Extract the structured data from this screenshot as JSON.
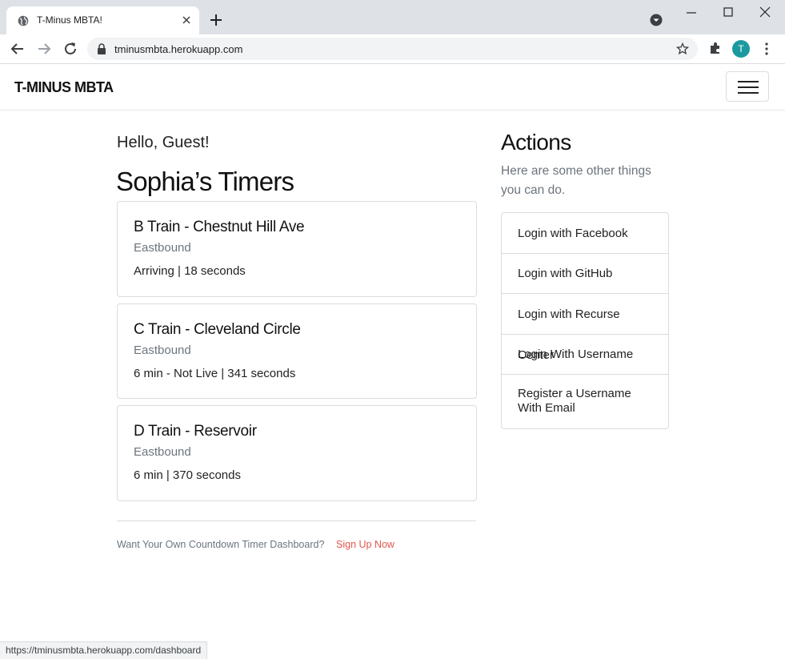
{
  "browser": {
    "tab_title": "T-Minus MBTA!",
    "url": "tminusmbta.herokuapp.com",
    "avatar_letter": "T",
    "status_url": "https://tminusmbta.herokuapp.com/dashboard"
  },
  "navbar": {
    "brand": "T-MINUS MBTA"
  },
  "main": {
    "greeting": "Hello, Guest!",
    "timers_title": "Sophia’s Timers",
    "timers": [
      {
        "title": "B Train - Chestnut Hill Ave",
        "direction": "Eastbound",
        "status": "Arriving | 18 seconds"
      },
      {
        "title": "C Train - Cleveland Circle",
        "direction": "Eastbound",
        "status": "6 min - Not Live | 341 seconds"
      },
      {
        "title": "D Train - Reservoir",
        "direction": "Eastbound",
        "status": "6 min | 370 seconds"
      }
    ],
    "footer_prompt": "Want Your Own Countdown Timer Dashboard?",
    "signup_link": "Sign Up Now"
  },
  "actions": {
    "title": "Actions",
    "description": "Here are some other things you can do.",
    "items": [
      {
        "label": "Login with Facebook"
      },
      {
        "label": "Login with GitHub"
      },
      {
        "label": "Login with Recurse Center"
      },
      {
        "label": "Login With Username"
      },
      {
        "label": "Register a Username With Email"
      }
    ]
  },
  "colors": {
    "link": "#e2574c",
    "muted": "#6c757d",
    "avatar": "#1a9aa0"
  }
}
